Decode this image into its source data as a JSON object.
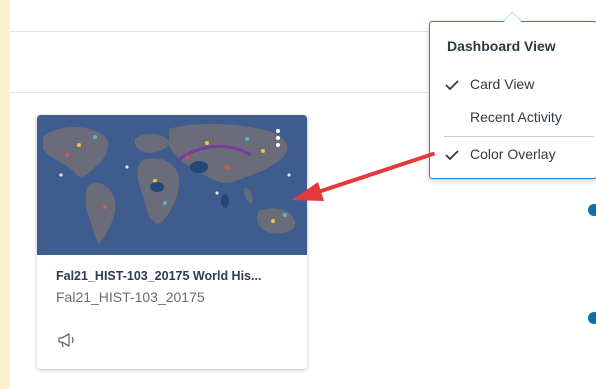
{
  "dashboard_view_menu": {
    "heading": "Dashboard View",
    "items": [
      {
        "label": "Card View",
        "checked": true
      },
      {
        "label": "Recent Activity",
        "checked": false
      },
      {
        "label": "Color Overlay",
        "checked": true
      }
    ]
  },
  "course_card": {
    "title": "Fal21_HIST-103_20175 World His...",
    "subtitle": "Fal21_HIST-103_20175",
    "overlay_color": "#3e5d8e",
    "icons": [
      "more-options-icon",
      "announcement-icon"
    ]
  },
  "colors": {
    "page_background": "#fdf0cf",
    "menu_border": "#2b7ec1",
    "annotation_arrow": "#e5383b",
    "accent_dot": "#0b6fb0"
  }
}
